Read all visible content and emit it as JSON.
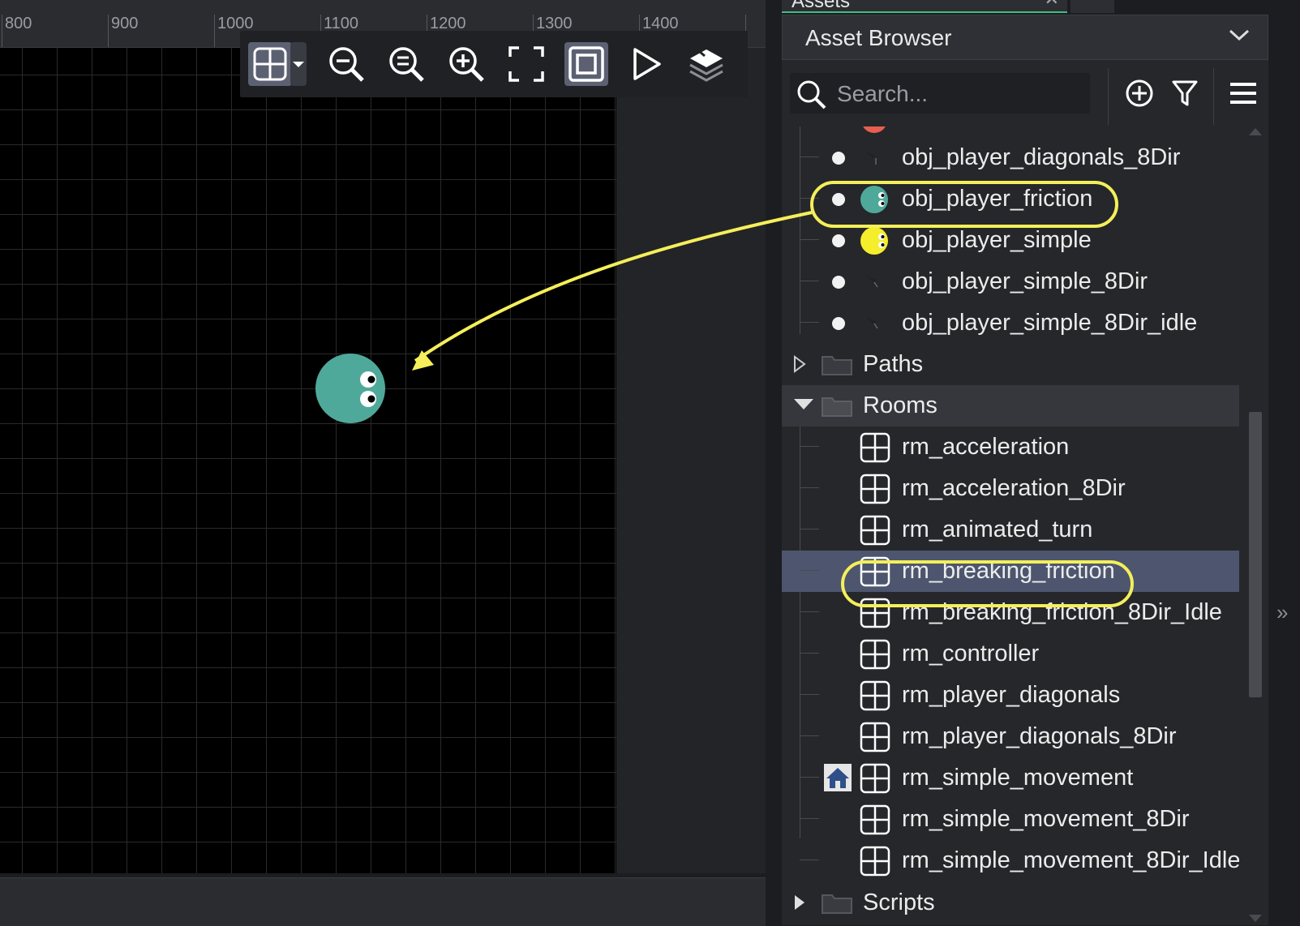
{
  "ruler": {
    "ticks": [
      "800",
      "900",
      "1000",
      "1100",
      "1200",
      "1300",
      "1400"
    ]
  },
  "toolbar": {
    "buttons": [
      "grid-toggle",
      "zoom-out",
      "zoom-reset",
      "zoom-in",
      "fullscreen",
      "frame-toggle",
      "play",
      "layers"
    ]
  },
  "panel": {
    "tab_label": "Assets",
    "tab_close": "✕",
    "tab_add": "+",
    "title": "Asset Browser",
    "search_placeholder": "Search..."
  },
  "tree": {
    "objects": [
      {
        "name": "obj_player_diagonals_8Dir",
        "sprite": "arrow"
      },
      {
        "name": "obj_player_friction",
        "sprite": "teal"
      },
      {
        "name": "obj_player_simple",
        "sprite": "yellow"
      },
      {
        "name": "obj_player_simple_8Dir",
        "sprite": "arrow"
      },
      {
        "name": "obj_player_simple_8Dir_idle",
        "sprite": "arrow"
      }
    ],
    "folders": {
      "paths": "Paths",
      "rooms": "Rooms",
      "scripts": "Scripts"
    },
    "rooms": [
      "rm_acceleration",
      "rm_acceleration_8Dir",
      "rm_animated_turn",
      "rm_breaking_friction",
      "rm_breaking_friction_8Dir_Idle",
      "rm_controller",
      "rm_player_diagonals",
      "rm_player_diagonals_8Dir",
      "rm_simple_movement",
      "rm_simple_movement_8Dir",
      "rm_simple_movement_8Dir_Idle"
    ],
    "selected_room": "rm_breaking_friction",
    "start_room": "rm_simple_movement"
  },
  "colors": {
    "highlight": "#f4ef5a",
    "teal_sprite": "#4fa99a",
    "yellow_sprite": "#f5ee2a",
    "selection": "#4d566e",
    "tab_accent": "#3fbf7f"
  }
}
